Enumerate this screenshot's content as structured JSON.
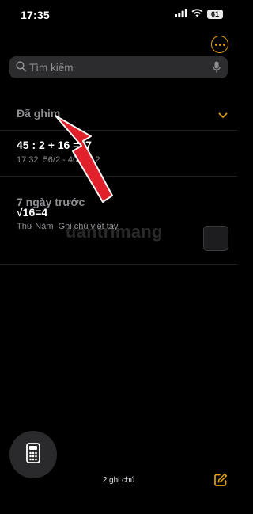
{
  "status": {
    "time": "17:35",
    "battery": "61"
  },
  "search": {
    "placeholder": "Tìm kiếm"
  },
  "sections": {
    "pinned": "Đã ghim",
    "last7days": "7 ngày trước"
  },
  "notes": [
    {
      "title": "45 : 2 + 16 =17",
      "time": "17:32",
      "preview": "56/2 - 40 = -12"
    },
    {
      "title": "√16=4",
      "time": "Thứ Năm",
      "preview": "Ghi chú viết tay"
    }
  ],
  "footer": {
    "note_count": "2 ghi chú"
  },
  "watermark": "uantrimang",
  "colors": {
    "accent": "#e3a10a",
    "background": "#000000",
    "annotation_arrow": "#e0202a"
  },
  "icons": [
    "wifi-icon",
    "battery-icon",
    "more-icon",
    "search-icon",
    "mic-icon",
    "chevron-down-icon",
    "calculator-icon",
    "compose-icon"
  ]
}
